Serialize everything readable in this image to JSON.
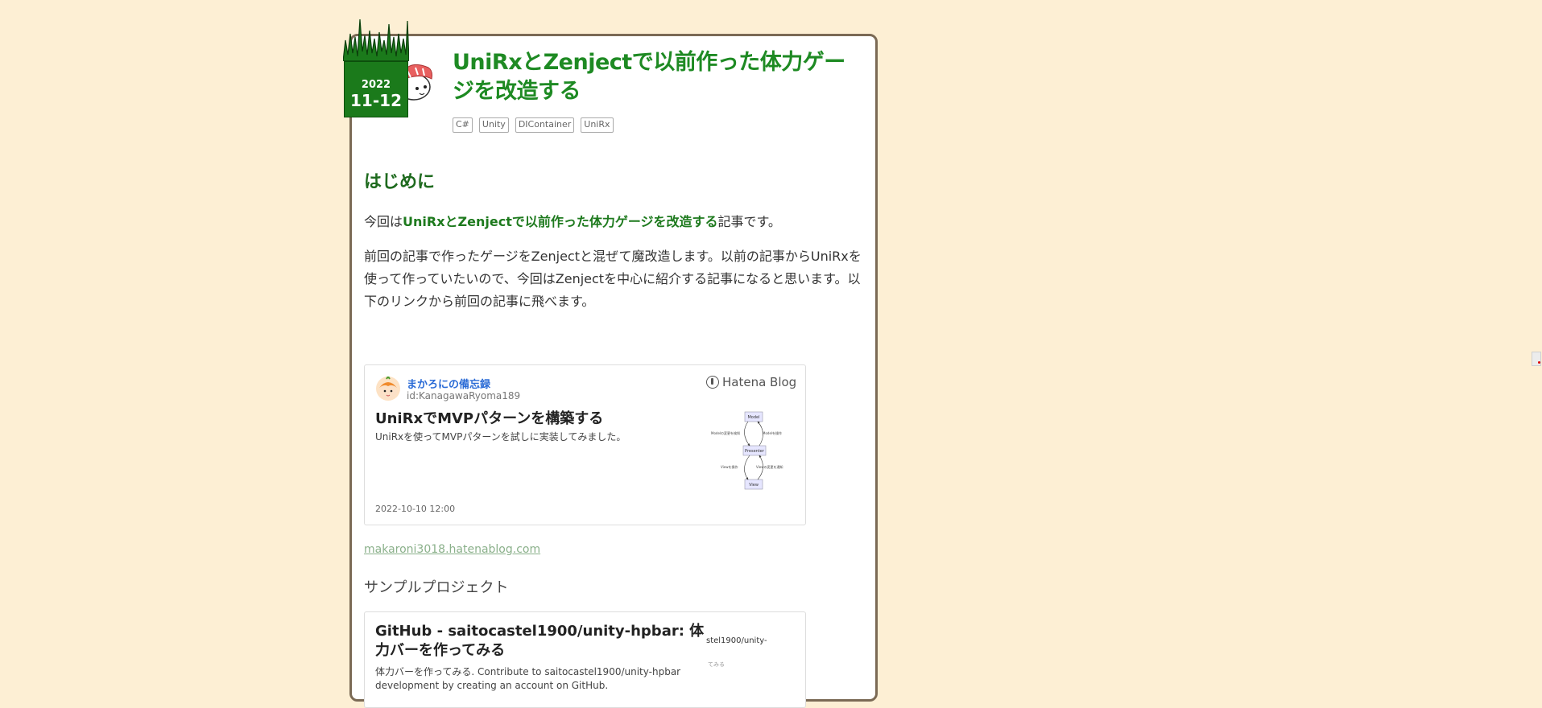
{
  "post": {
    "date_year": "2022",
    "date_md": "11-12",
    "title": "UniRxとZenjectで以前作った体力ゲージを改造する",
    "tags": [
      "C#",
      "Unity",
      "DIContainer",
      "UniRx"
    ]
  },
  "intro": {
    "heading": "はじめに",
    "p1_prefix": "今回は",
    "p1_highlight": "UniRxとZenjectで以前作った体力ゲージを改造する",
    "p1_suffix": "記事です。",
    "p2": "前回の記事で作ったゲージをZenjectと混ぜて魔改造します。以前の記事からUniRxを使って作っていたいので、今回はZenjectを中心に紹介する記事になると思います。以下のリンクから前回の記事に飛べます。"
  },
  "embed_card": {
    "blog_name": "まかろにの備忘録",
    "user_id": "id:KanagawaRyoma189",
    "brand": "Hatena Blog",
    "title": "UniRxでMVPパターンを構築する",
    "description": "UniRxを使ってMVPパターンを試しに実装してみました。",
    "date": "2022-10-10 12:00",
    "thumb_nodes": [
      "Model",
      "Presenter",
      "View"
    ],
    "thumb_edges": [
      "Modelの変更を検知",
      "Modelを操作",
      "Viewを操作",
      "Viewの変更を通知"
    ]
  },
  "link_url": "makaroni3018.hatenablog.com",
  "sample_heading": "サンプルプロジェクト",
  "github_card": {
    "title": "GitHub - saitocastel1900/unity-hpbar: 体力バーを作ってみる",
    "description": "体力バーを作ってみる. Contribute to saitocastel1900/unity-hpbar development by creating an account on GitHub.",
    "thumb_text": "stel1900/unity-",
    "thumb_text2": "てみる"
  },
  "colors": {
    "page_bg": "#fdefd4",
    "title_green": "#1e8a23",
    "badge_green": "#1b7a1b",
    "link_blue": "#2a6bd6"
  }
}
